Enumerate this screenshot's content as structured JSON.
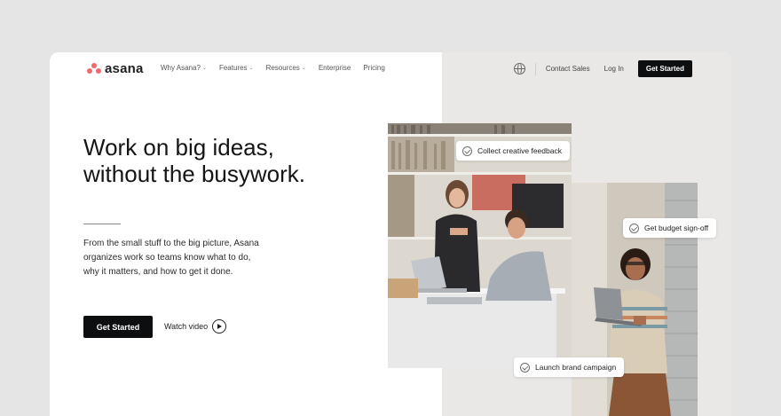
{
  "logo": {
    "text": "asana"
  },
  "nav": {
    "items": [
      {
        "label": "Why Asana?",
        "has_dropdown": true
      },
      {
        "label": "Features",
        "has_dropdown": true
      },
      {
        "label": "Resources",
        "has_dropdown": true
      },
      {
        "label": "Enterprise",
        "has_dropdown": false
      },
      {
        "label": "Pricing",
        "has_dropdown": false
      }
    ],
    "chevron": "⌄",
    "globe_icon": "globe-icon",
    "contact_sales": "Contact Sales",
    "log_in": "Log In",
    "get_started": "Get Started"
  },
  "hero": {
    "headline_line1": "Work on big ideas,",
    "headline_line2": "without the busywork.",
    "paragraph_line1": "From the small stuff to the big picture, Asana",
    "paragraph_line2": "organizes work so teams know what to do,",
    "paragraph_line3": "why it matters, and how to get it done.",
    "cta_label": "Get Started",
    "watch_label": "Watch video"
  },
  "chips": {
    "feedback": "Collect creative feedback",
    "budget": "Get budget sign-off",
    "launch": "Launch brand campaign"
  },
  "colors": {
    "accent": "#f06a6a",
    "button": "#0d0e10",
    "panel": "#eae8e6"
  }
}
